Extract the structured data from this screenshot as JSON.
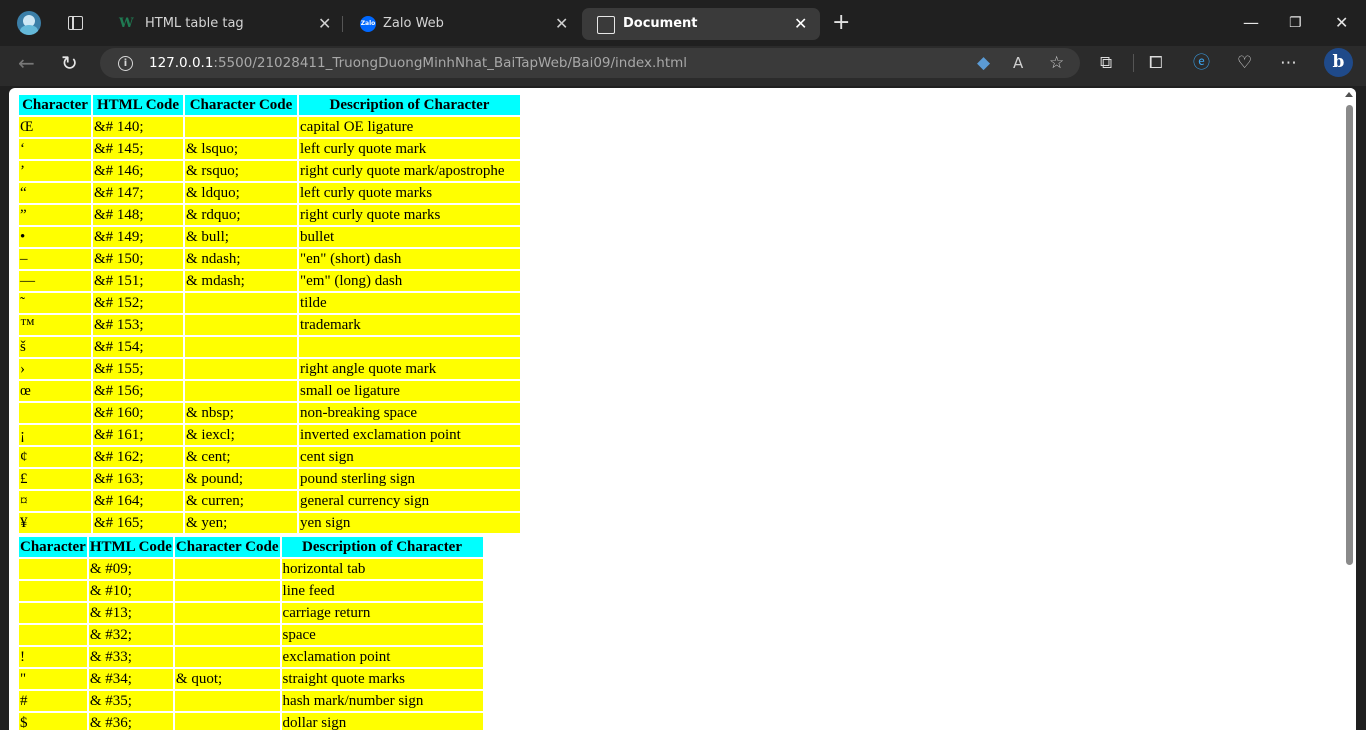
{
  "tabs": [
    {
      "title": "HTML table tag",
      "icon": "w3schools-icon",
      "active": false
    },
    {
      "title": "Zalo Web",
      "icon": "zalo-icon",
      "favicon_text": "Zalo",
      "active": false
    },
    {
      "title": "Document",
      "icon": "document-icon",
      "active": true
    }
  ],
  "address": {
    "host": "127.0.0.1",
    "path": ":5500/21028411_TruongDuongMinhNhat_BaiTapWeb/Bai09/index.html"
  },
  "tables": [
    {
      "headers": [
        "Character",
        "HTML Code",
        "Character Code",
        "Description of Character"
      ],
      "rows": [
        [
          "Œ",
          "&# 140;",
          "",
          "capital OE ligature"
        ],
        [
          "‘",
          "&# 145;",
          "& lsquo;",
          "left curly quote mark"
        ],
        [
          "’",
          "&# 146;",
          "& rsquo;",
          "right curly quote mark/apostrophe"
        ],
        [
          "“",
          "&# 147;",
          "& ldquo;",
          "left curly quote marks"
        ],
        [
          "”",
          "&# 148;",
          "& rdquo;",
          "right curly quote marks"
        ],
        [
          "•",
          "&# 149;",
          "& bull;",
          "bullet"
        ],
        [
          "–",
          "&# 150;",
          "& ndash;",
          "\"en\" (short) dash"
        ],
        [
          "—",
          "&# 151;",
          "& mdash;",
          "\"em\" (long) dash"
        ],
        [
          "˜",
          "&# 152;",
          "",
          "tilde"
        ],
        [
          "™",
          "&# 153;",
          "",
          "trademark"
        ],
        [
          "š",
          "&# 154;",
          "",
          ""
        ],
        [
          "›",
          "&# 155;",
          "",
          "right angle quote mark"
        ],
        [
          "œ",
          "&# 156;",
          "",
          "small oe ligature"
        ],
        [
          "",
          "&# 160;",
          "& nbsp;",
          "non-breaking space"
        ],
        [
          "¡",
          "&# 161;",
          "& iexcl;",
          "inverted exclamation point"
        ],
        [
          "¢",
          "&# 162;",
          "& cent;",
          "cent sign"
        ],
        [
          "£",
          "&# 163;",
          "& pound;",
          "pound sterling sign"
        ],
        [
          "¤",
          "&# 164;",
          "& curren;",
          "general currency sign"
        ],
        [
          "¥",
          "&# 165;",
          "& yen;",
          "yen sign"
        ]
      ]
    },
    {
      "headers": [
        "Character",
        "HTML Code",
        "Character Code",
        "Description of Character"
      ],
      "rows": [
        [
          "",
          "& #09;",
          "",
          "horizontal tab"
        ],
        [
          "",
          "& #10;",
          "",
          "line feed"
        ],
        [
          "",
          "& #13;",
          "",
          "carriage return"
        ],
        [
          "",
          "& #32;",
          "",
          "space"
        ],
        [
          "!",
          "& #33;",
          "",
          "exclamation point"
        ],
        [
          "\"",
          "& #34;",
          "& quot;",
          "straight quote marks"
        ],
        [
          "#",
          "& #35;",
          "",
          "hash mark/number sign"
        ],
        [
          "$",
          "& #36;",
          "",
          "dollar sign"
        ]
      ]
    }
  ],
  "colors": {
    "header_bg": "#00ffff",
    "cell_bg": "#ffff00"
  }
}
